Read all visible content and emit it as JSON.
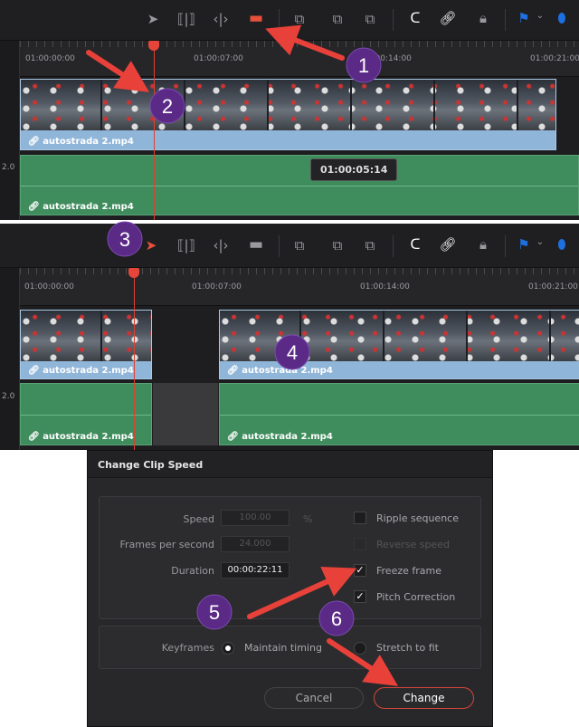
{
  "timeline_top": {
    "timecodes": [
      "01:00:00:00",
      "01:00:07:00",
      "01:00:14:00",
      "01:00:21:00"
    ],
    "track_label": "2.0",
    "video_clip": "autostrada 2.mp4",
    "audio_clip": "autostrada 2.mp4",
    "tooltip": "01:00:05:14",
    "active_tool": "blade-tool"
  },
  "timeline_bottom": {
    "timecodes": [
      "01:00:00:00",
      "01:00:07:00",
      "01:00:14:00",
      "01:00:21:00"
    ],
    "track_label": "2.0",
    "video_clips": [
      "autostrada 2.mp4",
      "autostrada 2.mp4"
    ],
    "audio_clips": [
      "autostrada 2.mp4",
      "autostrada 2.mp4"
    ],
    "active_tool": "selection-tool"
  },
  "dialog": {
    "title": "Change Clip Speed",
    "speed_label": "Speed",
    "speed_value": "100.00",
    "speed_unit": "%",
    "fps_label": "Frames per second",
    "fps_value": "24.000",
    "duration_label": "Duration",
    "duration_value": "00:00:22:11",
    "ripple_label": "Ripple sequence",
    "ripple_checked": false,
    "reverse_label": "Reverse speed",
    "reverse_checked": false,
    "freeze_label": "Freeze frame",
    "freeze_checked": true,
    "pitch_label": "Pitch Correction",
    "pitch_checked": true,
    "keyframes_label": "Keyframes",
    "maintain_label": "Maintain timing",
    "maintain_selected": true,
    "stretch_label": "Stretch to fit",
    "stretch_selected": false,
    "cancel_label": "Cancel",
    "change_label": "Change",
    "check_glyph": "✓"
  },
  "annotations": {
    "steps": [
      "1",
      "2",
      "3",
      "4",
      "5",
      "6"
    ],
    "arrow_color": "#e8413a",
    "badge_color": "#5b2a86"
  },
  "colors": {
    "video_clip": "#8fb5d8",
    "audio_clip": "#3f8c5d",
    "playhead": "#e6453a",
    "blade_active": "#e8503a",
    "marker_blue": "#1e6fe0"
  }
}
